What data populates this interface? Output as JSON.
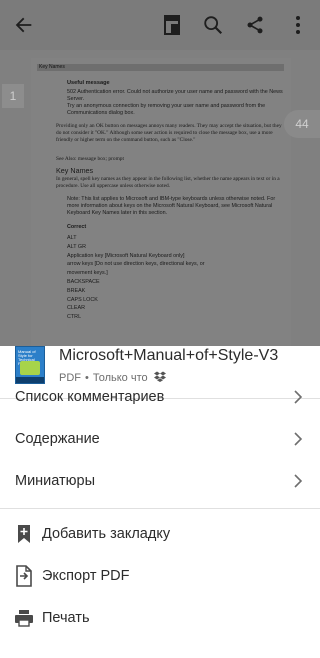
{
  "toolbar": {
    "back_icon": "arrow-left-icon",
    "reading_mode_icon": "reading-mode-icon",
    "search_icon": "search-icon",
    "share_icon": "share-icon",
    "more_icon": "more-vertical-icon"
  },
  "document": {
    "section_header": "Key Names",
    "useful_message_heading": "Useful message",
    "useful_message_line1": "502 Authentication error. Could not authorize your user name and password with the News Server.",
    "useful_message_line2": "Try an anonymous connection by removing your user name and password from the Communications dialog box.",
    "para1": "Providing only an OK button on messages annoys many readers. They may accept the situation, but they do not consider it \"OK.\" Although some user action is required to close the message box, use a more friendly or higher term on the command button, such as \"Close.\"",
    "see_also": "See Also: message box; prompt",
    "key_names_heading": "Key Names",
    "key_names_intro": "In general, spell key names as they appear in the following list, whether the name appears in text or in a procedure. Use all uppercase unless otherwise noted.",
    "note": "Note: This list applies to Microsoft and IBM-type keyboards unless otherwise noted. For more information about keys on the Microsoft Natural Keyboard, see Microsoft Natural Keyboard Key Names later in this section.",
    "correct_heading": "Correct",
    "keys": [
      "ALT",
      "ALT GR",
      "Application key [Microsoft Natural Keyboard only]",
      "arrow keys [Do not use direction keys, directional keys, or",
      "movement keys.]",
      "BACKSPACE",
      "BREAK",
      "CAPS LOCK",
      "CLEAR",
      "CTRL"
    ],
    "page_left": "1",
    "page_right": "44"
  },
  "sheet": {
    "file_title": "Microsoft+Manual+of+Style-V3",
    "file_type": "PDF",
    "file_separator": "•",
    "file_time": "Только что",
    "cloud_icon": "dropbox-icon",
    "thumbnail_text": "Manual of Style for Technical Publications",
    "items": [
      {
        "label": "Список комментариев",
        "icon": "chevron-right-icon"
      },
      {
        "label": "Содержание",
        "icon": "chevron-right-icon"
      },
      {
        "label": "Миниатюры",
        "icon": "chevron-right-icon"
      }
    ],
    "actions": [
      {
        "label": "Добавить закладку",
        "icon": "bookmark-add-icon"
      },
      {
        "label": "Экспорт PDF",
        "icon": "export-pdf-icon"
      },
      {
        "label": "Печать",
        "icon": "print-icon"
      }
    ]
  }
}
